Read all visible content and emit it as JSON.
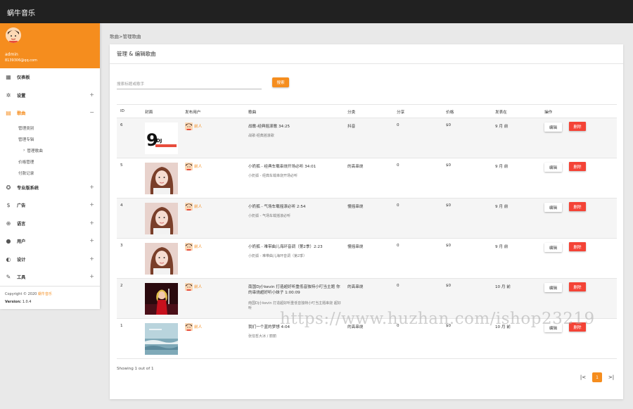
{
  "app": {
    "title": "蜗牛音乐"
  },
  "user": {
    "name": "admin",
    "email": "8139306@qq.com"
  },
  "sidebar": {
    "items": [
      {
        "label": "仪表板",
        "icon": "dashboard-icon",
        "glyph": "▦",
        "toggle": ""
      },
      {
        "label": "设置",
        "icon": "gear-icon",
        "glyph": "✲",
        "toggle": "+"
      },
      {
        "label": "歌曲",
        "icon": "music-library-icon",
        "glyph": "▤",
        "toggle": "−",
        "active": true
      },
      {
        "label": "专业版系统",
        "icon": "star-badge-icon",
        "glyph": "✪",
        "toggle": "+"
      },
      {
        "label": "广告",
        "icon": "dollar-icon",
        "glyph": "$",
        "toggle": "+"
      },
      {
        "label": "语言",
        "icon": "globe-icon",
        "glyph": "⊕",
        "toggle": "+"
      },
      {
        "label": "用户",
        "icon": "account-icon",
        "glyph": "●",
        "toggle": "+"
      },
      {
        "label": "设计",
        "icon": "palette-icon",
        "glyph": "◐",
        "toggle": "+"
      },
      {
        "label": "工具",
        "icon": "wrench-icon",
        "glyph": "✎",
        "toggle": "+"
      }
    ],
    "submenu": [
      {
        "label": "管理类别"
      },
      {
        "label": "管理专辑"
      },
      {
        "label": "管理歌曲",
        "current": true,
        "arrow": "›"
      },
      {
        "label": "价格管理"
      },
      {
        "label": "付款记录"
      }
    ],
    "copyright_prefix": "Copyright © 2020",
    "copyright_brand": "蜗牛音乐",
    "version_label": "Version:",
    "version_value": "1.0.4"
  },
  "breadcrumb": "歌曲>管理歌曲",
  "card": {
    "title": "管理 & 编辑歌曲",
    "search_placeholder": "搜索标题或歌手",
    "search_button": "搜索"
  },
  "table": {
    "columns": [
      "ID",
      "封面",
      "发布用户",
      "歌曲",
      "分类",
      "分享",
      "价格",
      "发表在",
      "操作"
    ],
    "edit_label": "编辑",
    "delete_label": "删除",
    "rows": [
      {
        "id": "6",
        "cover": "logo",
        "user": "前人",
        "title": "战歌-经典摇滚歌 34:25",
        "artist": "战歌-经典摇滚歌",
        "category": "抖音",
        "shares": "0",
        "price": "$0",
        "posted": "9 月 前"
      },
      {
        "id": "5",
        "cover": "girl",
        "user": "前人",
        "title": "小奶狐 - 经典车载串烧开场必听 34:01",
        "artist": "小奶狐 - 经典车载串烧开场必听",
        "category": "的高串烧",
        "shares": "0",
        "price": "$0",
        "posted": "9 月 前"
      },
      {
        "id": "4",
        "cover": "girl",
        "user": "前人",
        "title": "小奶狐 - 气场车载摇滚必听 2:54",
        "artist": "小奶狐 - 气场车载摇滚必听",
        "category": "慢摇串烧",
        "shares": "0",
        "price": "$0",
        "posted": "9 月 前"
      },
      {
        "id": "3",
        "cover": "girl",
        "user": "前人",
        "title": "小奶狐 - 难带曲儿海环音调（第2季）2:23",
        "artist": "小奶狐 - 难带曲儿海环音调（第2季）",
        "category": "慢摇串烧",
        "shares": "0",
        "price": "$0",
        "posted": "9 月 前"
      },
      {
        "id": "2",
        "cover": "singer",
        "user": "前人",
        "title": "南国Dj小kevin 打造超好听重低音独特小叮当主题 你的串烧超好听小妹子 1:00:09",
        "artist": "南国Dj小kevin 打造超好听重低音独特小叮当主题串烧 超好听",
        "category": "的高串烧",
        "shares": "0",
        "price": "$0",
        "posted": "10 月 前"
      },
      {
        "id": "1",
        "cover": "sea",
        "user": "前人",
        "title": "我们一个蓝的梦想 4:04",
        "artist": "张信哲大冰 / 丽丽",
        "category": "的高串烧",
        "shares": "0",
        "price": "$0",
        "posted": "10 月 前"
      }
    ]
  },
  "pagination": {
    "showing": "Showing 1 out of 1",
    "first": "|<",
    "current": "1",
    "last": ">|"
  },
  "watermark": "https://www.huzhan.com/ishop23219",
  "colors": {
    "accent": "#f58d1e",
    "danger": "#f44336",
    "topbar": "#212121"
  }
}
